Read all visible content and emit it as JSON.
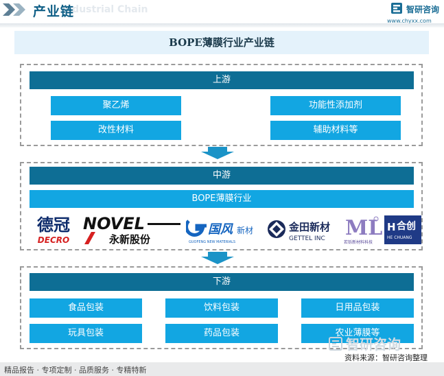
{
  "header": {
    "title": "产业链",
    "ghost_text": "Industrial Chain",
    "logo_name": "智研咨询",
    "logo_url": "www.chyxx.com"
  },
  "diagram": {
    "title": "BOPE薄膜行业产业链",
    "upstream": {
      "label": "上游",
      "items": [
        "聚乙烯",
        "功能性添加剂",
        "改性材料",
        "辅助材料等"
      ]
    },
    "midstream": {
      "label": "中游",
      "industry": "BOPE薄膜行业",
      "companies": [
        {
          "cn": "德冠",
          "en": "DECRO"
        },
        {
          "cn": "永新股份",
          "en": "NOVEL"
        },
        {
          "cn": "国风新材",
          "en": "GUOFENG NEW MATERIALS"
        },
        {
          "cn": "金田新材",
          "en": "GETTEL INC"
        },
        {
          "cn": "若铄新材料科技",
          "en": "ML"
        },
        {
          "cn": "合创",
          "en": "HE CHUANG"
        }
      ]
    },
    "downstream": {
      "label": "下游",
      "items": [
        "食品包装",
        "饮料包装",
        "日用品包装",
        "玩具包装",
        "药品包装",
        "农业薄膜等"
      ]
    }
  },
  "footer": {
    "tagline": "精品报告 · 专项定制 · 品质服务 · 专精特新",
    "source": "资料来源：智研咨询整理",
    "watermark": "智研咨询"
  },
  "colors": {
    "dark_bar": "#0e6e95",
    "light_box": "#12a6e2",
    "title_bg": "#e4f2fb",
    "brand": "#1a6d95"
  }
}
